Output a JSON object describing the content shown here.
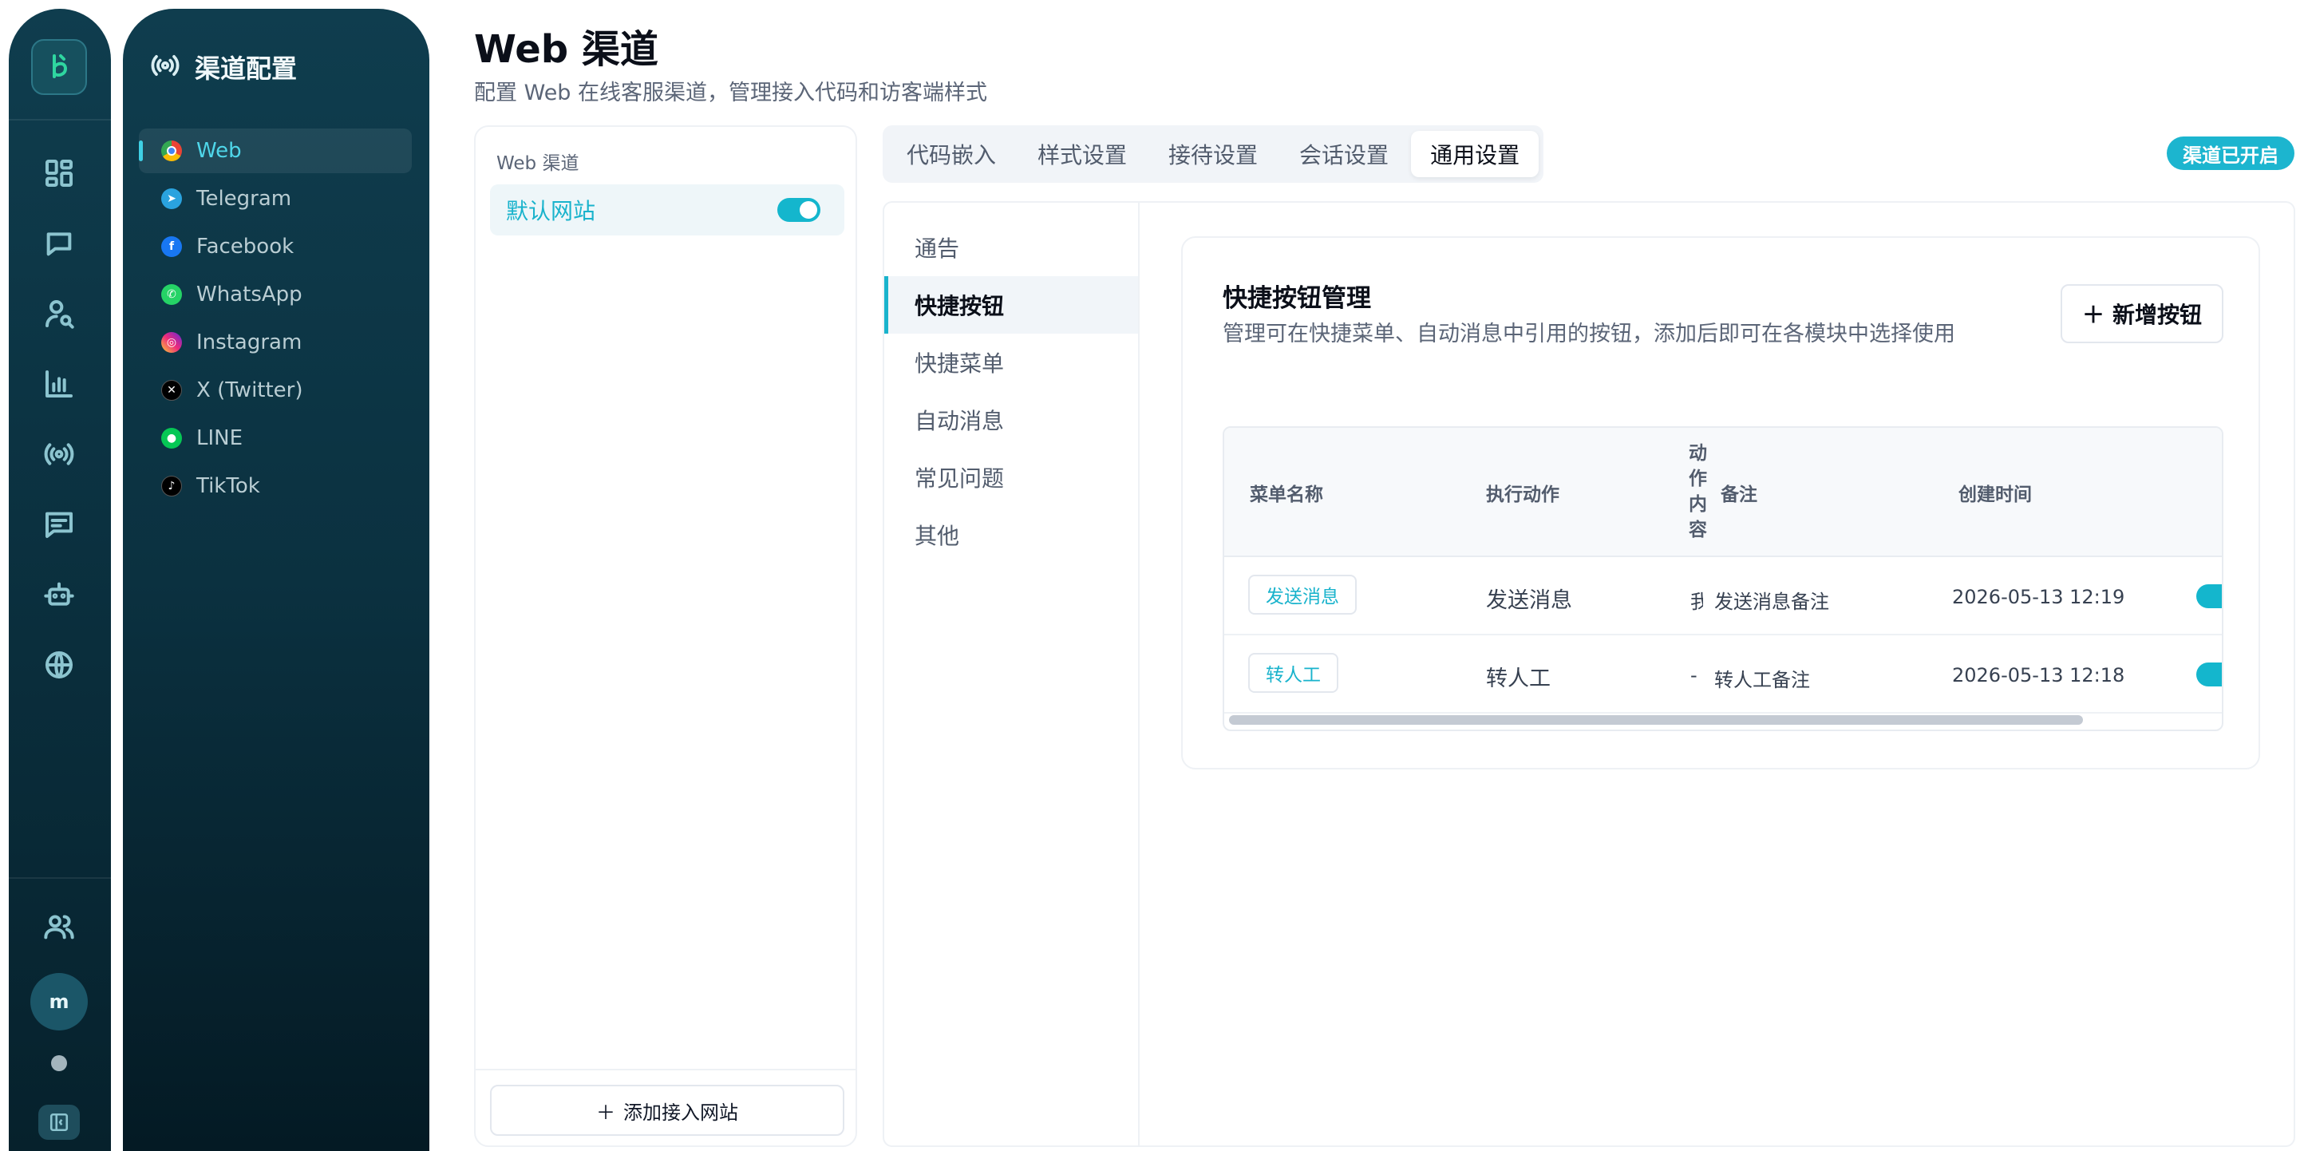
{
  "rail": {
    "avatar_initial": "m",
    "icons": [
      "dashboard-icon",
      "chat-icon",
      "visitor-search-icon",
      "analytics-icon",
      "broadcast-icon",
      "message-icon",
      "bot-icon",
      "globe-icon",
      "team-icon",
      "collapse-sidebar-icon"
    ],
    "accent": "#2fd6a0"
  },
  "channel_panel": {
    "title": "渠道配置",
    "items": [
      {
        "label": "Web",
        "icon": "chrome-icon",
        "active": true
      },
      {
        "label": "Telegram",
        "icon": "telegram-icon"
      },
      {
        "label": "Facebook",
        "icon": "facebook-icon"
      },
      {
        "label": "WhatsApp",
        "icon": "whatsapp-icon"
      },
      {
        "label": "Instagram",
        "icon": "instagram-icon"
      },
      {
        "label": "X (Twitter)",
        "icon": "x-icon"
      },
      {
        "label": "LINE",
        "icon": "line-icon"
      },
      {
        "label": "TikTok",
        "icon": "tiktok-icon"
      }
    ]
  },
  "header": {
    "title": "Web 渠道",
    "subtitle": "配置 Web 在线客服渠道，管理接入代码和访客端样式"
  },
  "sites": {
    "label": "Web 渠道",
    "items": [
      {
        "name": "默认网站",
        "enabled": true
      }
    ],
    "add_label": "添加接入网站"
  },
  "tabs": [
    "代码嵌入",
    "样式设置",
    "接待设置",
    "会话设置",
    "通用设置"
  ],
  "active_tab": "通用设置",
  "status_badge": "渠道已开启",
  "settings_nav": [
    "通告",
    "快捷按钮",
    "快捷菜单",
    "自动消息",
    "常见问题",
    "其他"
  ],
  "active_settings_nav": "快捷按钮",
  "card": {
    "title": "快捷按钮管理",
    "description": "管理可在快捷菜单、自动消息中引用的按钮，添加后即可在各模块中选择使用",
    "add_button": "新增按钮"
  },
  "table": {
    "columns": {
      "name": "菜单名称",
      "action": "执行动作",
      "action_content": "动作内容",
      "note": "备注",
      "created": "创建时间"
    },
    "rows": [
      {
        "name": "发送消息",
        "action": "发送消息",
        "content": "我",
        "note": "发送消息备注",
        "created": "2026-05-13 12:19",
        "enabled": true
      },
      {
        "name": "转人工",
        "action": "转人工",
        "content": "-",
        "note": "转人工备注",
        "created": "2026-05-13 12:18",
        "enabled": true
      }
    ]
  },
  "colors": {
    "primary": "#19b3cc",
    "sidebar_dark": "#0b3140"
  }
}
